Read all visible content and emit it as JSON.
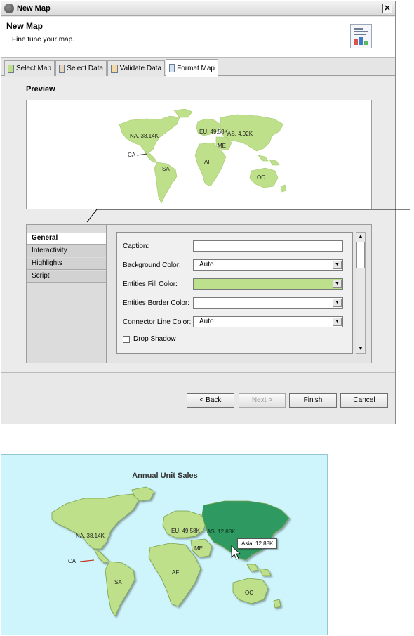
{
  "window": {
    "title": "New Map",
    "close_glyph": "✕"
  },
  "header": {
    "title": "New Map",
    "subtitle": "Fine tune your map."
  },
  "tabs": [
    {
      "label": "Select Map",
      "icon": "map-select-icon"
    },
    {
      "label": "Select Data",
      "icon": "data-select-icon"
    },
    {
      "label": "Validate Data",
      "icon": "validate-icon"
    },
    {
      "label": "Format Map",
      "icon": "format-map-icon",
      "active": true
    }
  ],
  "preview": {
    "label": "Preview",
    "labels": {
      "na": "NA, 38.14K",
      "eu": "EU, 49.58K",
      "as": "AS, 4.92K",
      "me": "ME",
      "ca": "CA",
      "af": "AF",
      "sa": "SA",
      "oc": "OC"
    },
    "land_color": "#bfe08a"
  },
  "properties": {
    "nav": [
      "General",
      "Interactivity",
      "Highlights",
      "Script"
    ],
    "selected_nav": "General",
    "fields": {
      "caption_label": "Caption:",
      "caption_value": "",
      "bg_label": "Background Color:",
      "bg_value": "Auto",
      "fill_label": "Entities Fill Color:",
      "fill_color": "#bde08c",
      "border_label": "Entities Border Color:",
      "border_value": "",
      "connector_label": "Connector Line Color:",
      "connector_value": "Auto",
      "shadow_label": "Drop Shadow",
      "shadow_checked": false
    }
  },
  "buttons": {
    "back": "< Back",
    "next": "Next >",
    "finish": "Finish",
    "cancel": "Cancel"
  },
  "final_map": {
    "title": "Annual Unit Sales",
    "background": "#cdf5fb",
    "land_color": "#bfe08a",
    "highlight_color": "#2e9a62",
    "labels": {
      "na": "NA, 38.14K",
      "eu": "EU, 49.58K",
      "as": "AS, 12.88K",
      "me": "ME",
      "ca": "CA",
      "af": "AF",
      "sa": "SA",
      "oc": "OC"
    },
    "tooltip": "Asia, 12.88K"
  }
}
